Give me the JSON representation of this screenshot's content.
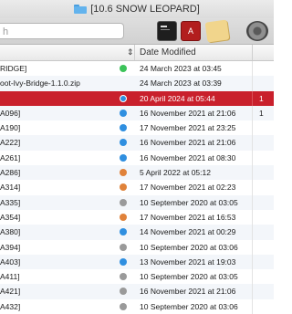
{
  "window": {
    "title": "[10.6 SNOW LEOPARD]"
  },
  "toolbar": {
    "search_text": "h",
    "icons": [
      "terminal-icon",
      "acrobat-icon",
      "stickies-icon",
      "system-preferences-icon"
    ],
    "acrobat_glyph": "A"
  },
  "columns": {
    "date_modified": "Date Modified",
    "sort_glyph": "⇕"
  },
  "colors": {
    "green": "#3cc35a",
    "blue": "#2f8fe0",
    "orange": "#e0823a",
    "gray": "#9a9a9a",
    "selection": "#c9202c"
  },
  "rows": [
    {
      "name": "RIDGE]",
      "dot": "green",
      "date": "24 March 2023 at 03:45",
      "size": ""
    },
    {
      "name": "oot-Ivy-Bridge-1.1.0.zip",
      "dot": "none",
      "date": "24 March 2023 at 03:39",
      "size": ""
    },
    {
      "name": "",
      "dot": "blue",
      "date": "20 April 2024 at 05:44",
      "size": "1",
      "selected": true
    },
    {
      "name": "A096]",
      "dot": "blue",
      "date": "16 November 2021 at 21:06",
      "size": "1"
    },
    {
      "name": "A190]",
      "dot": "blue",
      "date": "17 November 2021 at 23:25",
      "size": ""
    },
    {
      "name": "A222]",
      "dot": "blue",
      "date": "16 November 2021 at 21:06",
      "size": ""
    },
    {
      "name": "A261]",
      "dot": "blue",
      "date": "16 November 2021 at 08:30",
      "size": ""
    },
    {
      "name": "A286]",
      "dot": "orange",
      "date": "5 April 2022 at 05:12",
      "size": ""
    },
    {
      "name": "A314]",
      "dot": "orange",
      "date": "17 November 2021 at 02:23",
      "size": ""
    },
    {
      "name": "A335]",
      "dot": "gray",
      "date": "10 September 2020 at 03:05",
      "size": ""
    },
    {
      "name": "A354]",
      "dot": "orange",
      "date": "17 November 2021 at 16:53",
      "size": ""
    },
    {
      "name": "A380]",
      "dot": "blue",
      "date": "14 November 2021 at 00:29",
      "size": ""
    },
    {
      "name": "A394]",
      "dot": "gray",
      "date": "10 September 2020 at 03:06",
      "size": ""
    },
    {
      "name": "A403]",
      "dot": "blue",
      "date": "13 November 2021 at 19:03",
      "size": ""
    },
    {
      "name": "A411]",
      "dot": "gray",
      "date": "10 September 2020 at 03:05",
      "size": ""
    },
    {
      "name": "A421]",
      "dot": "gray",
      "date": "16 November 2021 at 21:06",
      "size": ""
    },
    {
      "name": "A432]",
      "dot": "gray",
      "date": "10 September 2020 at 03:06",
      "size": ""
    }
  ]
}
